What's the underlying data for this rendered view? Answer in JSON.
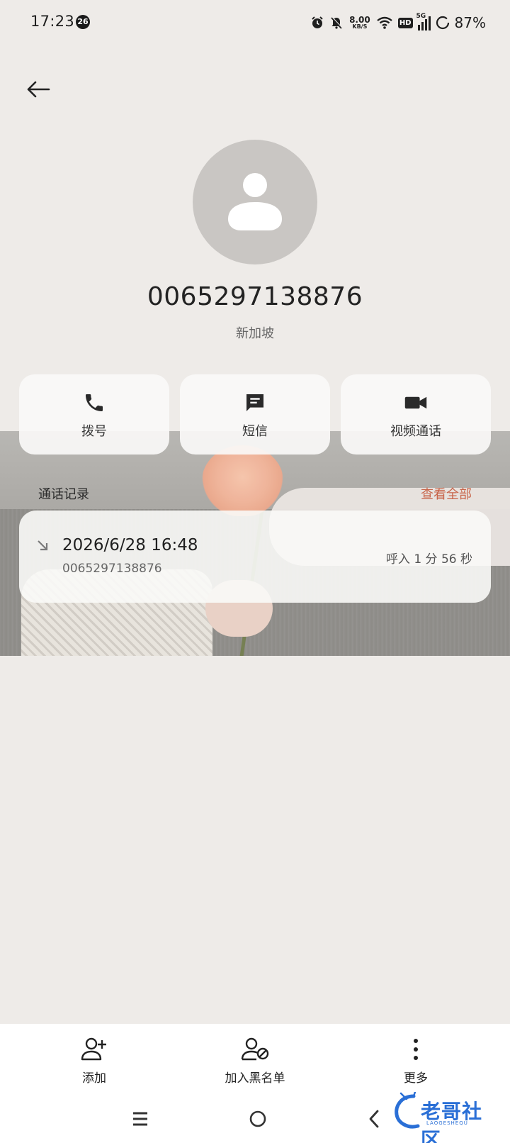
{
  "status_bar": {
    "time": "17:23",
    "notification_count": "26",
    "net_speed_value": "8.00",
    "net_speed_unit": "KB/S",
    "hd_label": "HD",
    "signal_label": "5G",
    "battery": "87%"
  },
  "contact": {
    "number": "0065297138876",
    "location": "新加坡"
  },
  "actions": [
    {
      "label": "拨号",
      "icon": "phone-icon"
    },
    {
      "label": "短信",
      "icon": "message-icon"
    },
    {
      "label": "视频通话",
      "icon": "video-icon"
    }
  ],
  "call_history": {
    "title": "通话记录",
    "view_all": "查看全部",
    "items": [
      {
        "direction_icon": "incoming-call-arrow-icon",
        "datetime": "2026/6/28 16:48",
        "number": "0065297138876",
        "info": "呼入 1 分 56 秒"
      }
    ]
  },
  "bottom_bar": {
    "add": "添加",
    "blacklist": "加入黑名单",
    "more": "更多"
  },
  "watermark": {
    "text": "老哥社区",
    "sub": "LAOGESHEQU"
  },
  "colors": {
    "background": "#eeebe8",
    "accent": "#c8654a",
    "avatar_bg": "#c9c6c3",
    "card_bg": "#faf9f7"
  }
}
